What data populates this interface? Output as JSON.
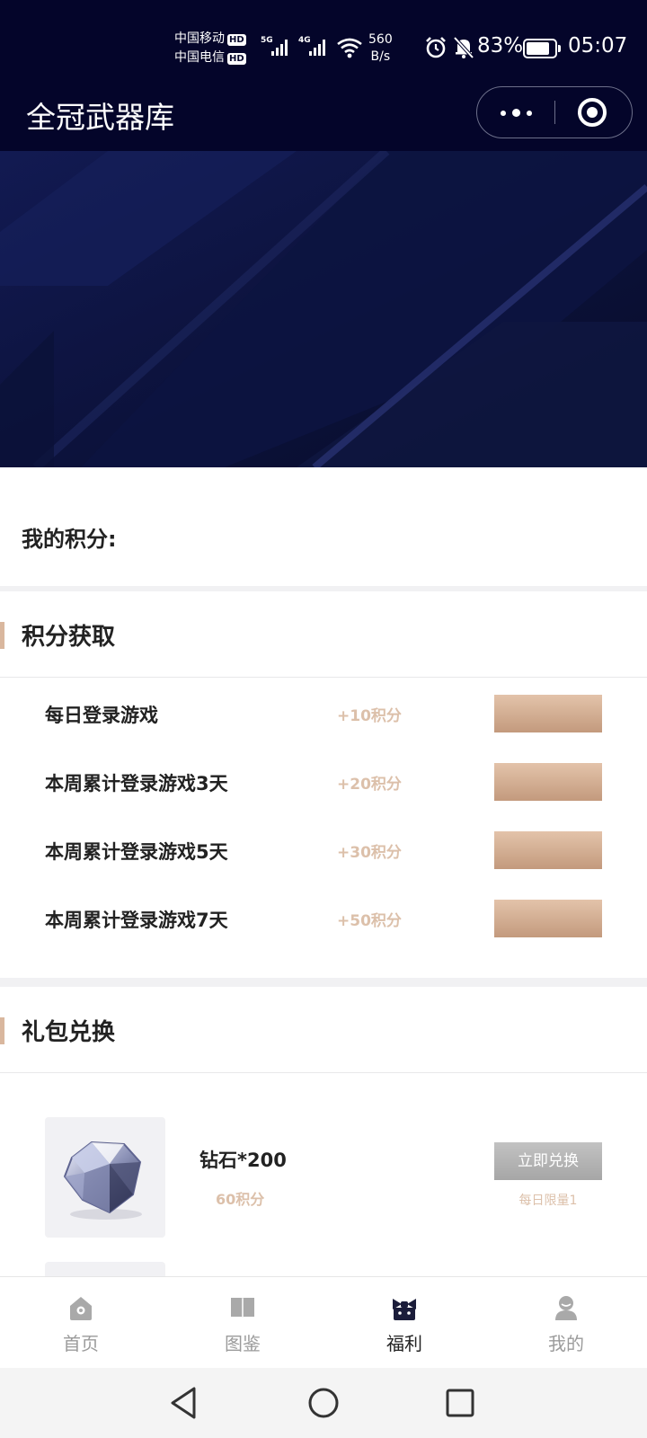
{
  "status_bar": {
    "carrier1": "中国移动",
    "carrier2": "中国电信",
    "hd_badge": "HD",
    "signal1_label": "5G",
    "signal2_label": "4G",
    "net_speed_value": "560",
    "net_speed_unit": "B/s",
    "battery_percent": "83%",
    "time": "05:07"
  },
  "app": {
    "title": "全冠武器库"
  },
  "points": {
    "label": "我的积分:"
  },
  "earn_section": {
    "title": "积分获取",
    "tasks": [
      {
        "name": "每日登录游戏",
        "reward": "+10积分"
      },
      {
        "name": "本周累计登录游戏3天",
        "reward": "+20积分"
      },
      {
        "name": "本周累计登录游戏5天",
        "reward": "+30积分"
      },
      {
        "name": "本周累计登录游戏7天",
        "reward": "+50积分"
      }
    ]
  },
  "gift_section": {
    "title": "礼包兑换",
    "items": [
      {
        "name": "钻石*200",
        "cost": "60积分",
        "button": "立即兑换",
        "limit": "每日限量1",
        "icon": "diamond-icon"
      }
    ]
  },
  "tabbar": {
    "tabs": [
      {
        "label": "首页",
        "icon": "home-icon"
      },
      {
        "label": "图鉴",
        "icon": "book-icon"
      },
      {
        "label": "福利",
        "icon": "gift-icon"
      },
      {
        "label": "我的",
        "icon": "user-icon"
      }
    ],
    "active": "福利"
  },
  "colors": {
    "header_bg": "#04052a",
    "accent_gold": "#d9b79e",
    "points_text": "#dcc0aa",
    "disabled_button": "#b3b3b3"
  }
}
